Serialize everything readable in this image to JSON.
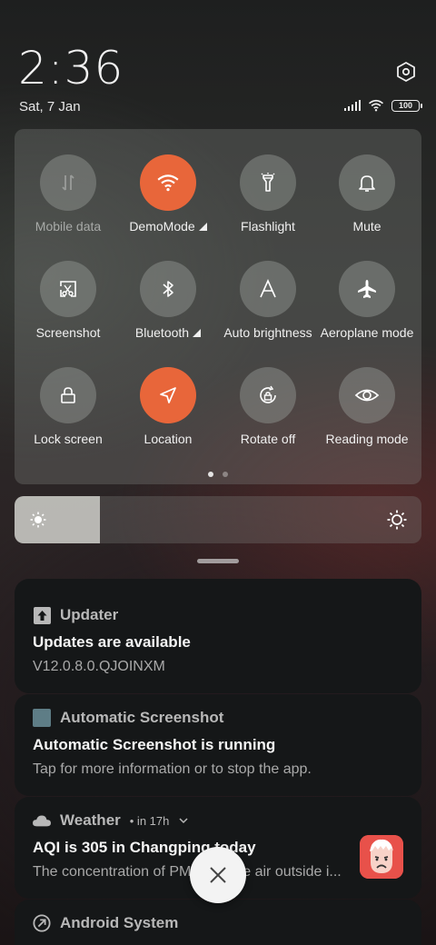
{
  "status": {
    "time": "2:36",
    "date": "Sat, 7 Jan",
    "battery": "100"
  },
  "quick_settings": {
    "tiles": [
      {
        "label": "Mobile data",
        "icon": "mobile-data-icon",
        "active": false
      },
      {
        "label": "DemoMode",
        "icon": "wifi-icon",
        "active": true
      },
      {
        "label": "Flashlight",
        "icon": "flashlight-icon",
        "active": false
      },
      {
        "label": "Mute",
        "icon": "bell-icon",
        "active": false
      },
      {
        "label": "Screenshot",
        "icon": "screenshot-icon",
        "active": false
      },
      {
        "label": "Bluetooth",
        "icon": "bluetooth-icon",
        "active": false
      },
      {
        "label": "Auto brightness",
        "icon": "auto-brightness-icon",
        "active": false
      },
      {
        "label": "Aeroplane mode",
        "icon": "airplane-icon",
        "active": false
      },
      {
        "label": "Lock screen",
        "icon": "lock-icon",
        "active": false
      },
      {
        "label": "Location",
        "icon": "location-icon",
        "active": true
      },
      {
        "label": "Rotate off",
        "icon": "rotate-lock-icon",
        "active": false
      },
      {
        "label": "Reading mode",
        "icon": "eye-icon",
        "active": false
      }
    ],
    "page_count": 2,
    "current_page": 1
  },
  "brightness": {
    "level": 0.21
  },
  "notifications": [
    {
      "app": "Updater",
      "title": "Updates are available",
      "body": "V12.0.8.0.QJOINXM"
    },
    {
      "app": "Automatic Screenshot",
      "title": "Automatic Screenshot is running",
      "body": "Tap for more information or to stop the app."
    },
    {
      "app": "Weather",
      "meta": "• in 17h",
      "title": "AQI is 305 in Changping today",
      "body": "The concentration of PM2.5 in the air outside i..."
    },
    {
      "app": "Android System"
    }
  ],
  "colors": {
    "accent": "#e8663a"
  }
}
